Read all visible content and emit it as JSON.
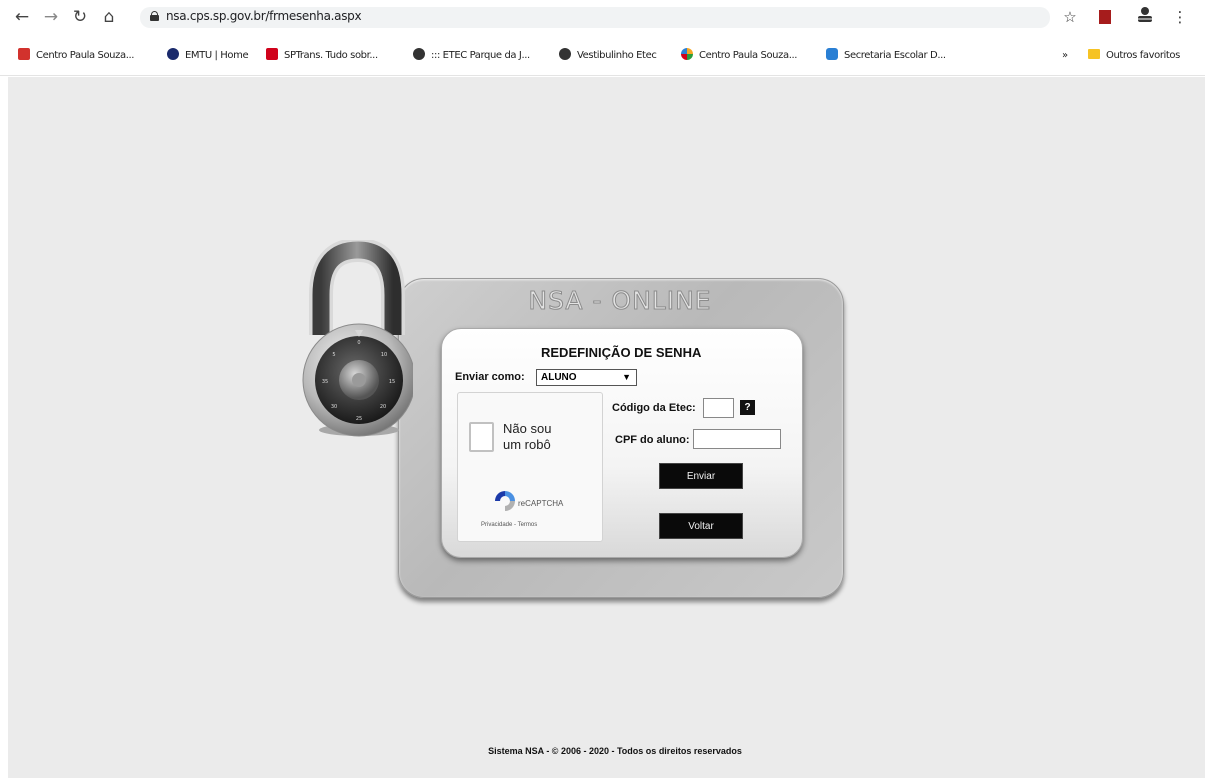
{
  "browser": {
    "url": "nsa.cps.sp.gov.br/frmesenha.aspx",
    "bookmarks": [
      {
        "label": "Centro Paula Souza...",
        "color": "#d2322d"
      },
      {
        "label": "EMTU | Home",
        "color": "#1a2a6c"
      },
      {
        "label": "SPTrans. Tudo sobr...",
        "color": "#d0021b"
      },
      {
        "label": "::: ETEC Parque da J...",
        "color": "#333333"
      },
      {
        "label": "Vestibulinho Etec",
        "color": "#333333"
      },
      {
        "label": "Centro Paula Souza...",
        "color": "#f5a623"
      },
      {
        "label": "Secretaria Escolar D...",
        "color": "#2a7fd4"
      }
    ],
    "more_label": "»",
    "other_bookmarks": "Outros favoritos"
  },
  "app": {
    "title": "NSA - ONLINE",
    "heading": "REDEFINIÇÃO DE SENHA",
    "send_as_label": "Enviar como:",
    "send_as_value": "ALUNO",
    "recaptcha": {
      "label": "Não sou um robô",
      "brand": "reCAPTCHA",
      "links": "Privacidade - Termos"
    },
    "etec_code_label": "Código da Etec:",
    "help_label": "?",
    "cpf_label": "CPF do aluno:",
    "send_button": "Enviar",
    "back_button": "Voltar"
  },
  "footer": "Sistema NSA - © 2006 - 2020 - Todos os direitos reservados"
}
